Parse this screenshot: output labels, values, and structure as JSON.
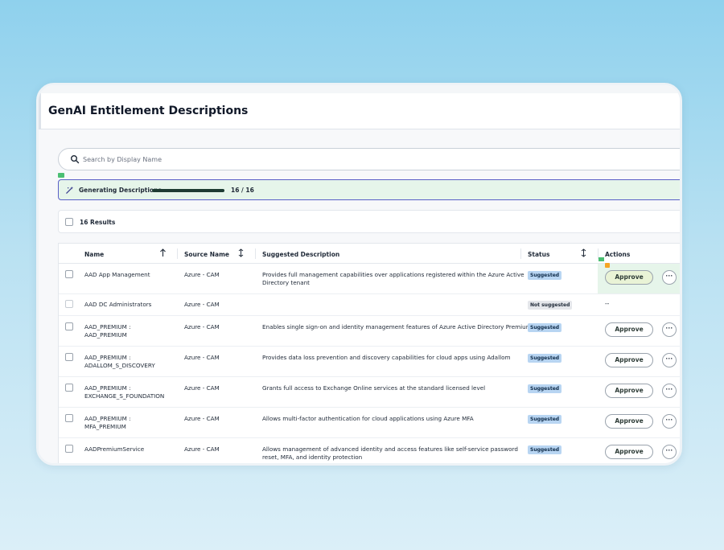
{
  "page_title": "GenAI Entitlement Descriptions",
  "search": {
    "placeholder": "Search by Display Name"
  },
  "progress": {
    "label": "Generating Descriptions",
    "count_text": "16 / 16",
    "fraction": 1.0
  },
  "results": {
    "label": "16 Results"
  },
  "table": {
    "columns": {
      "name": "Name",
      "source": "Source Name",
      "description": "Suggested Description",
      "status": "Status",
      "actions": "Actions"
    },
    "rows": [
      {
        "name_l1": "AAD App Management",
        "name_l2": "",
        "source": "Azure - CAM",
        "desc_l1": "Provides full management capabilities over applications registered within the Azure Active",
        "desc_l2": "Directory tenant",
        "status": "Suggested",
        "action": "Approve",
        "more": "···"
      },
      {
        "name_l1": "AAD DC Administrators",
        "name_l2": "",
        "source": "Azure - CAM",
        "desc_l1": "",
        "desc_l2": "",
        "status": "Not suggested",
        "action": "--",
        "more": ""
      },
      {
        "name_l1": "AAD_PREMIUM :",
        "name_l2": "AAD_PREMIUM",
        "source": "Azure - CAM",
        "desc_l1": "Enables single sign-on and identity management features of Azure Active Directory Premium",
        "desc_l2": "",
        "status": "Suggested",
        "action": "Approve",
        "more": "···"
      },
      {
        "name_l1": "AAD_PREMIUM :",
        "name_l2": "ADALLOM_S_DISCOVERY",
        "source": "Azure - CAM",
        "desc_l1": "Provides data loss prevention and discovery capabilities for cloud apps using Adallom",
        "desc_l2": "",
        "status": "Suggested",
        "action": "Approve",
        "more": "···"
      },
      {
        "name_l1": "AAD_PREMIUM :",
        "name_l2": "EXCHANGE_S_FOUNDATION",
        "source": "Azure - CAM",
        "desc_l1": "Grants full access to Exchange Online services at the standard licensed level",
        "desc_l2": "",
        "status": "Suggested",
        "action": "Approve",
        "more": "···"
      },
      {
        "name_l1": "AAD_PREMIUM :",
        "name_l2": "MFA_PREMIUM",
        "source": "Azure - CAM",
        "desc_l1": "Allows multi-factor authentication for cloud applications using Azure MFA",
        "desc_l2": "",
        "status": "Suggested",
        "action": "Approve",
        "more": "···"
      },
      {
        "name_l1": "AADPremiumService",
        "name_l2": "",
        "source": "Azure - CAM",
        "desc_l1": "Allows management of advanced identity and access features like self-service password",
        "desc_l2": "reset, MFA, and identity protection",
        "status": "Suggested",
        "action": "Approve",
        "more": "···"
      }
    ]
  },
  "colors": {
    "progress_bg": "#e6f5ea",
    "progress_border": "#5a5fc7",
    "badge_suggested": "#b8d5f2",
    "badge_not_suggested": "#e5e7eb",
    "approve_highlight": "#e9f3d6"
  },
  "icons": {
    "search": "search-icon",
    "generate": "magic-wand-icon",
    "sort_asc": "arrow-up-icon",
    "sort_both": "sort-arrows-icon",
    "more": "more-horizontal-icon"
  }
}
